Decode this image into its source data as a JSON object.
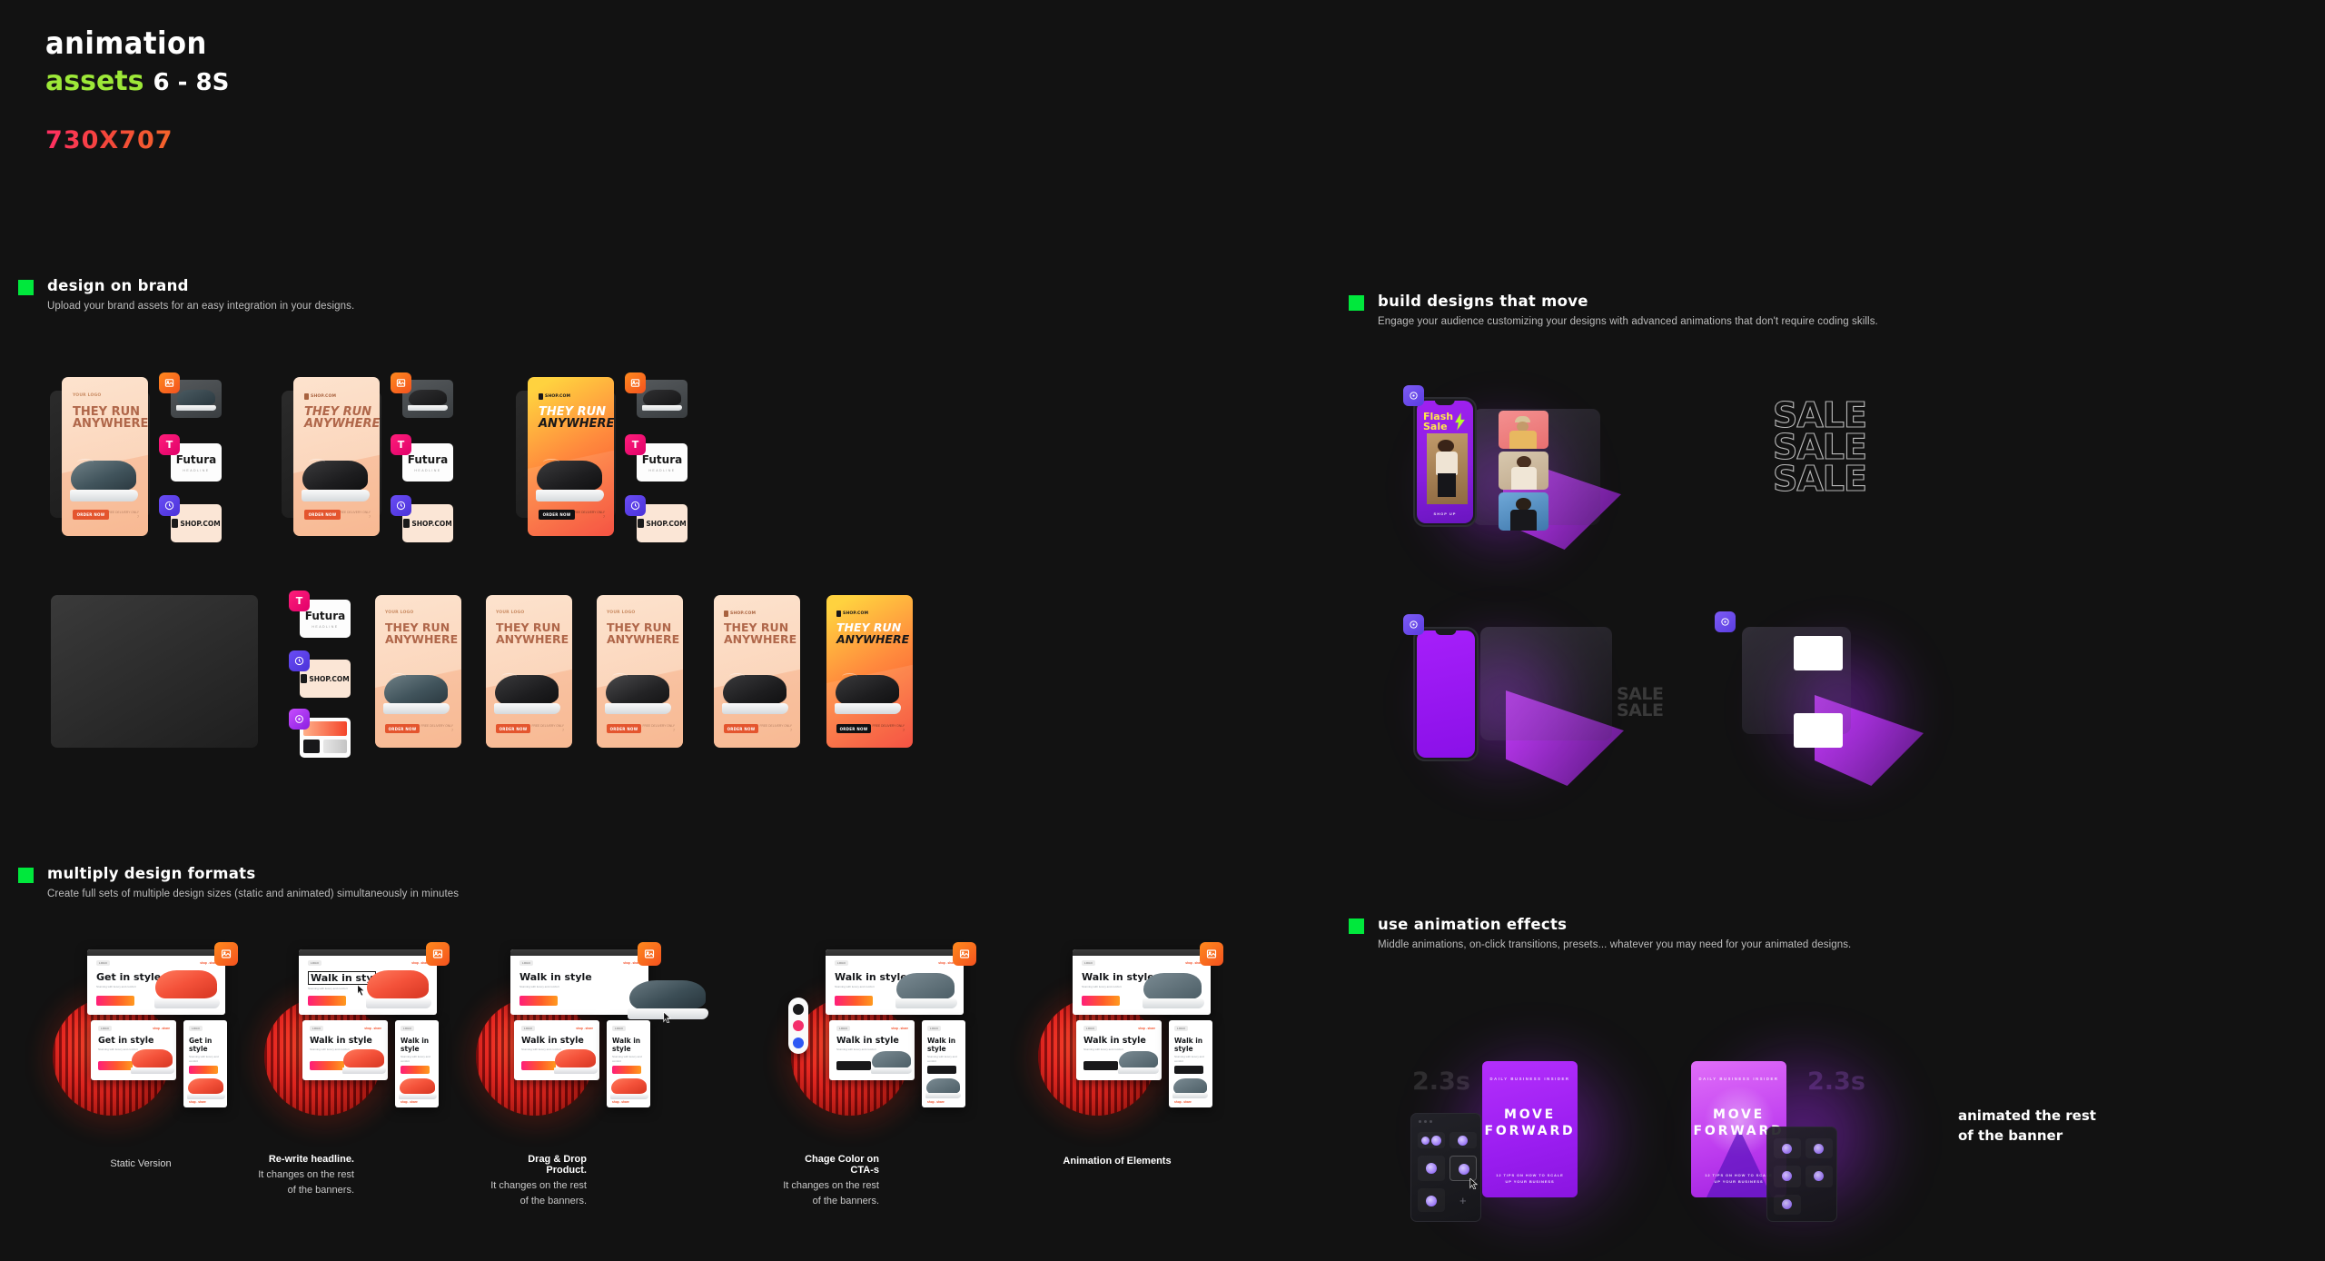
{
  "title": {
    "line1": "ANIMATION",
    "assets": "ASSETS",
    "duration": "6 - 8S",
    "dimensions": "730X707",
    "accent_green": "#9de838",
    "accent_pink": "#ff2e63"
  },
  "sections": [
    {
      "id": "design-on-brand",
      "title": "DESIGN ON BRAND",
      "subtitle": "Upload your brand assets for an easy integration in your designs."
    },
    {
      "id": "build-designs-that-move",
      "title": "BUILD DESIGNS THAT MOVE",
      "subtitle": "Engage your audience customizing your designs with advanced animations that don't require coding skills."
    },
    {
      "id": "multiply-design-formats",
      "title": "MULTIPLY DESIGN FORMATS",
      "subtitle": "Create full sets of multiple design sizes (static and animated) simultaneously in minutes"
    },
    {
      "id": "use-animation-effects",
      "title": "USE ANIMATION EFFECTS",
      "subtitle": "Middle animations, on-click transitions, presets... whatever you may need for your animated designs."
    }
  ],
  "banner": {
    "logo_placeholder": "YOUR LOGO",
    "logo_brand": "SHOP.COM",
    "headline_l1": "THEY RUN",
    "headline_l2": "ANYWHERE",
    "cta": "ORDER NOW",
    "fine_print": "FREE DELIVERY ONLY 7"
  },
  "assets": {
    "image_tag": "image-asset",
    "type_tag": "T",
    "logo_tag": "logo-asset",
    "palette_tag": "palette-asset",
    "font_name": "Futura",
    "font_sub": "HEADLINE",
    "brand_name": "SHOP.COM"
  },
  "formats": {
    "headline_a": "Get in style",
    "headline_b": "Walk in style",
    "headline_editing": "Walk in sty",
    "subcopy": "Stunning with luxury and comfort",
    "cta": "SHOP NOW",
    "shop_link": "shop . share",
    "tag": "LOGO"
  },
  "format_captions": [
    {
      "title": "Static Version",
      "body": ""
    },
    {
      "title": "Re-write headline.",
      "body": "It changes on the rest of the banners."
    },
    {
      "title": "Drag & Drop Product.",
      "body": "It changes on the rest of the banners."
    },
    {
      "title": "Chage Color on CTA-s",
      "body": "It changes on the rest of the banners."
    },
    {
      "title": "Animation of Elements",
      "body": ""
    }
  ],
  "move": {
    "flash_l1": "Flash",
    "flash_l2": "Sale",
    "shop_cta": "SHOP UP",
    "sale_text": "SALE",
    "sale_lines": [
      "SALE",
      "SALE",
      "SALE"
    ],
    "sale_dim_lines": [
      "SALE",
      "SALE"
    ]
  },
  "effects": {
    "timing": "2.3s",
    "timing_alt": "2.3s",
    "poster_kicker": "DAILY BUSINESS INSIDER",
    "poster_h1": "MOVE",
    "poster_h2": "FORWARD",
    "poster_footer_l1": "12 TIPS ON HOW TO SCALE",
    "poster_footer_l2": "UP YOUR BUSINESS",
    "note_l1": "ANIMATED THE REST",
    "note_l2": "OF THE BANNER"
  }
}
